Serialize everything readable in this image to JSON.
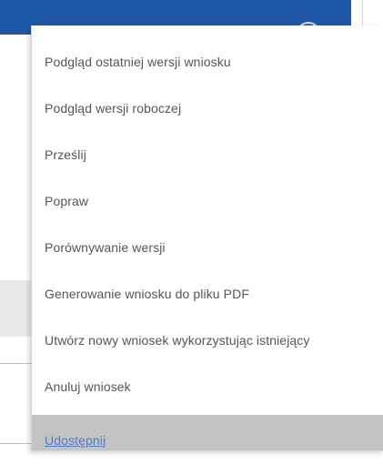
{
  "menu": {
    "items": [
      {
        "label": "Podgląd ostatniej wersji wniosku"
      },
      {
        "label": "Podgląd wersji roboczej"
      },
      {
        "label": "Prześlij"
      },
      {
        "label": "Popraw"
      },
      {
        "label": "Porównywanie wersji"
      },
      {
        "label": "Generowanie wniosku do pliku PDF"
      },
      {
        "label": "Utwórz nowy wniosek wykorzystując istniejący"
      },
      {
        "label": "Anuluj wniosek"
      },
      {
        "label": "Udostępnij"
      }
    ]
  },
  "colors": {
    "header_blue": "#1f57a6",
    "menu_text": "#555555",
    "active_background": "#c3c3c3",
    "active_link": "#4f7fc9"
  }
}
